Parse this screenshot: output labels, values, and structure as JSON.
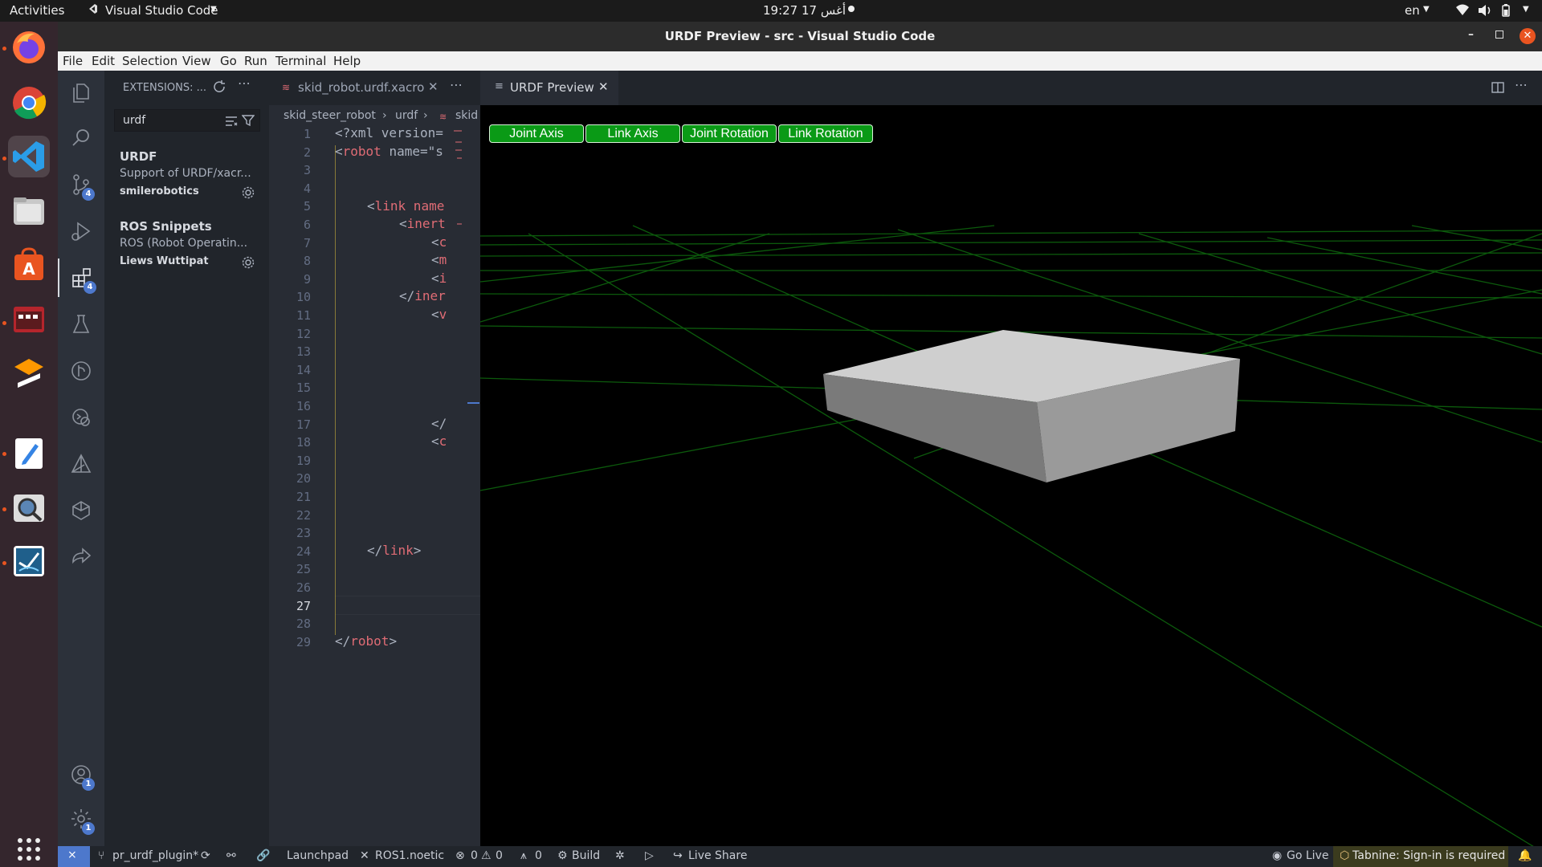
{
  "topbar": {
    "activities": "Activities",
    "app_menu": "Visual Studio Code",
    "clock": "19:27  17 أغس",
    "lang": "en"
  },
  "window": {
    "title": "URDF Preview - src - Visual Studio Code"
  },
  "menu": [
    "File",
    "Edit",
    "Selection",
    "View",
    "Go",
    "Run",
    "Terminal",
    "Help"
  ],
  "activity_badges": {
    "source_control": "4",
    "extensions": "4",
    "accounts": "1",
    "manage": "1"
  },
  "sidebar": {
    "header": "EXTENSIONS: ...",
    "search_value": "urdf",
    "extensions": [
      {
        "name": "URDF",
        "description": "Support of URDF/xacr...",
        "publisher": "smilerobotics"
      },
      {
        "name": "ROS Snippets",
        "description": "ROS (Robot Operatin...",
        "publisher": "Liews Wuttipat"
      }
    ]
  },
  "editor1": {
    "tab_label": "skid_robot.urdf.xacro",
    "breadcrumb": [
      "skid_steer_robot",
      "urdf",
      "skid"
    ],
    "line_numbers": [
      "1",
      "2",
      "3",
      "4",
      "5",
      "6",
      "7",
      "8",
      "9",
      "10",
      "11",
      "12",
      "13",
      "14",
      "15",
      "16",
      "17",
      "18",
      "19",
      "20",
      "21",
      "22",
      "23",
      "24",
      "25",
      "26",
      "27",
      "28",
      "29"
    ],
    "code": {
      "l1_a": "<?",
      "l1_b": "xml version=",
      "l2_a": "<",
      "l2_b": "robot",
      "l2_c": " name=\"s",
      "l5_a": "<",
      "l5_b": "link name",
      "l6_a": "<",
      "l6_b": "inert",
      "l7_a": "<",
      "l7_b": "c",
      "l8_a": "<",
      "l8_b": "m",
      "l9_a": "<",
      "l9_b": "i",
      "l10_a": "</",
      "l10_b": "iner",
      "l11_a": "<",
      "l11_b": "v",
      "l17_a": "</",
      "l18_a": "<",
      "l18_b": "c",
      "l24_a": "</",
      "l24_b": "link",
      "l24_c": ">",
      "l29_a": "</",
      "l29_b": "robot",
      "l29_c": ">"
    }
  },
  "editor2": {
    "tab_label": "URDF Preview",
    "buttons": [
      "Joint Axis",
      "Link Axis",
      "Joint Rotation",
      "Link Rotation"
    ]
  },
  "statusbar": {
    "branch": "pr_urdf_plugin*",
    "launchpad": "Launchpad",
    "ros": "ROS1.noetic",
    "errors": "0",
    "warnings": "0",
    "ports": "0",
    "build": "Build",
    "live_share": "Live Share",
    "go_live": "Go Live",
    "tabnine": "Tabnine: Sign-in is required"
  },
  "colors": {
    "status_accent": "#4d78cc",
    "tabnine_bg": "#3b3b1e",
    "preview_button": "#0a9a16",
    "grid": "#0c5a0c",
    "box_top": "#cfcfcf",
    "box_front": "#7a7a7a",
    "box_side": "#9a9a9a"
  }
}
